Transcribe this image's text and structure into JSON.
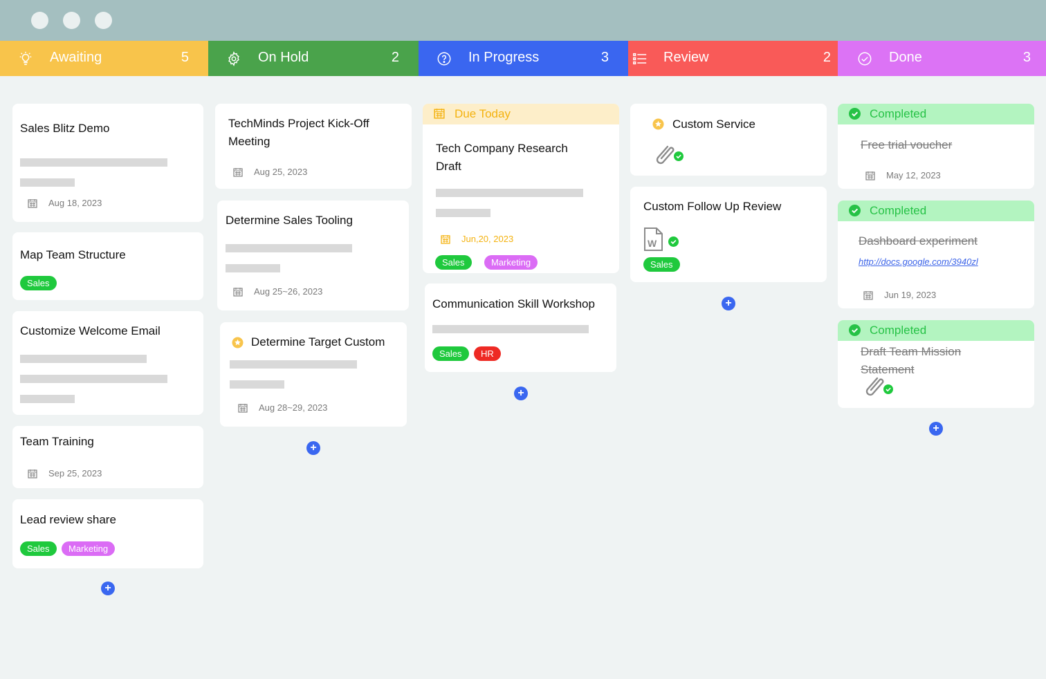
{
  "columns": [
    {
      "label": "Awaiting",
      "count": "5",
      "color": "#f8c44b",
      "icon": "lightbulb-icon"
    },
    {
      "label": "On Hold",
      "count": "2",
      "color": "#4aa34b",
      "icon": "gear-icon"
    },
    {
      "label": "In Progress",
      "count": "3",
      "color": "#3a66f0",
      "icon": "question-circle-icon"
    },
    {
      "label": "Review",
      "count": "2",
      "color": "#f95a58",
      "icon": "list-icon"
    },
    {
      "label": "Done",
      "count": "3",
      "color": "#dc73f5",
      "icon": "check-circle-icon"
    }
  ],
  "tags": {
    "sales": "Sales",
    "marketing": "Marketing",
    "hr": "HR"
  },
  "awaiting": {
    "c1": {
      "title": "Sales Blitz Demo",
      "date": "Aug 18, 2023"
    },
    "c2": {
      "title": "Map Team Structure"
    },
    "c3": {
      "title": "Customize Welcome Email"
    },
    "c4": {
      "title": "Team Training",
      "date": "Sep 25, 2023"
    },
    "c5": {
      "title": "Lead review share"
    }
  },
  "onhold": {
    "c1": {
      "title_line1": "TechMinds Project Kick-Off",
      "title_line2": "Meeting",
      "date": "Aug 25, 2023"
    },
    "c2": {
      "title": "Determine Sales Tooling",
      "date": "Aug 25~26, 2023"
    },
    "c3": {
      "title": "Determine Target Custom",
      "date": "Aug 28~29, 2023"
    }
  },
  "inprogress": {
    "c1": {
      "banner": "Due Today",
      "title_line1": "Tech Company Research",
      "title_line2": "Draft",
      "date": "Jun,20, 2023"
    },
    "c2": {
      "title": "Communication Skill Workshop"
    }
  },
  "review": {
    "c1": {
      "title": "Custom Service"
    },
    "c2": {
      "title": "Custom Follow Up Review"
    }
  },
  "done": {
    "c1": {
      "banner": "Completed",
      "title": "Free trial voucher",
      "date": "May 12, 2023"
    },
    "c2": {
      "banner": "Completed",
      "title": "Dashboard experiment",
      "link": "http://docs.google.com/3940zl",
      "date": "Jun 19, 2023"
    },
    "c3": {
      "banner": "Completed",
      "title_line1": "Draft Team Mission",
      "title_line2": "Statement"
    }
  },
  "add_label": "+"
}
